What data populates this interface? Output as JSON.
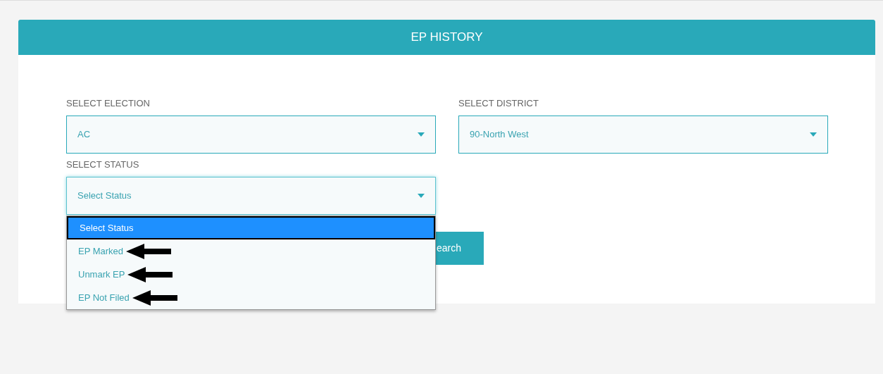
{
  "header": {
    "title": "EP HISTORY"
  },
  "fields": [
    {
      "label": "SELECT ELECTION",
      "value": "AC"
    },
    {
      "label": "SELECT DISTRICT",
      "value": "90-North West"
    }
  ],
  "status_field": {
    "label": "SELECT STATUS",
    "value": "Select Status",
    "expanded": true,
    "options": [
      {
        "label": "Select Status",
        "selected": true,
        "marked": false
      },
      {
        "label": "EP Marked",
        "selected": false,
        "marked": true
      },
      {
        "label": "Unmark EP",
        "selected": false,
        "marked": true
      },
      {
        "label": "EP Not Filed",
        "selected": false,
        "marked": true
      }
    ]
  },
  "search_button": {
    "label": "earch"
  }
}
